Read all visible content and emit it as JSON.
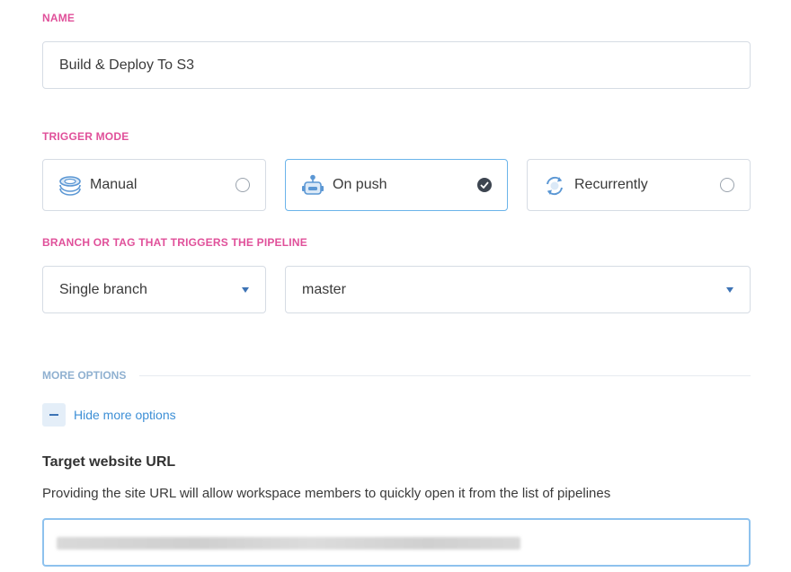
{
  "name_section": {
    "label": "NAME",
    "value": "Build & Deploy To S3"
  },
  "trigger_section": {
    "label": "TRIGGER MODE",
    "modes": [
      {
        "label": "Manual",
        "icon": "stack-icon",
        "selected": false
      },
      {
        "label": "On push",
        "icon": "robot-icon",
        "selected": true
      },
      {
        "label": "Recurrently",
        "icon": "refresh-icon",
        "selected": false
      }
    ]
  },
  "branch_section": {
    "label": "BRANCH OR TAG THAT TRIGGERS THE PIPELINE",
    "type_select": "Single branch",
    "branch_select": "master"
  },
  "more_options": {
    "label": "MORE OPTIONS",
    "toggle_label": "Hide more options"
  },
  "target_url": {
    "title": "Target website URL",
    "description": "Providing the site URL will allow workspace members to quickly open it from the list of pipelines",
    "value": ""
  },
  "colors": {
    "section_label": "#e0509a",
    "accent_blue": "#3d8fd6",
    "selected_border": "#6bb4ea"
  }
}
